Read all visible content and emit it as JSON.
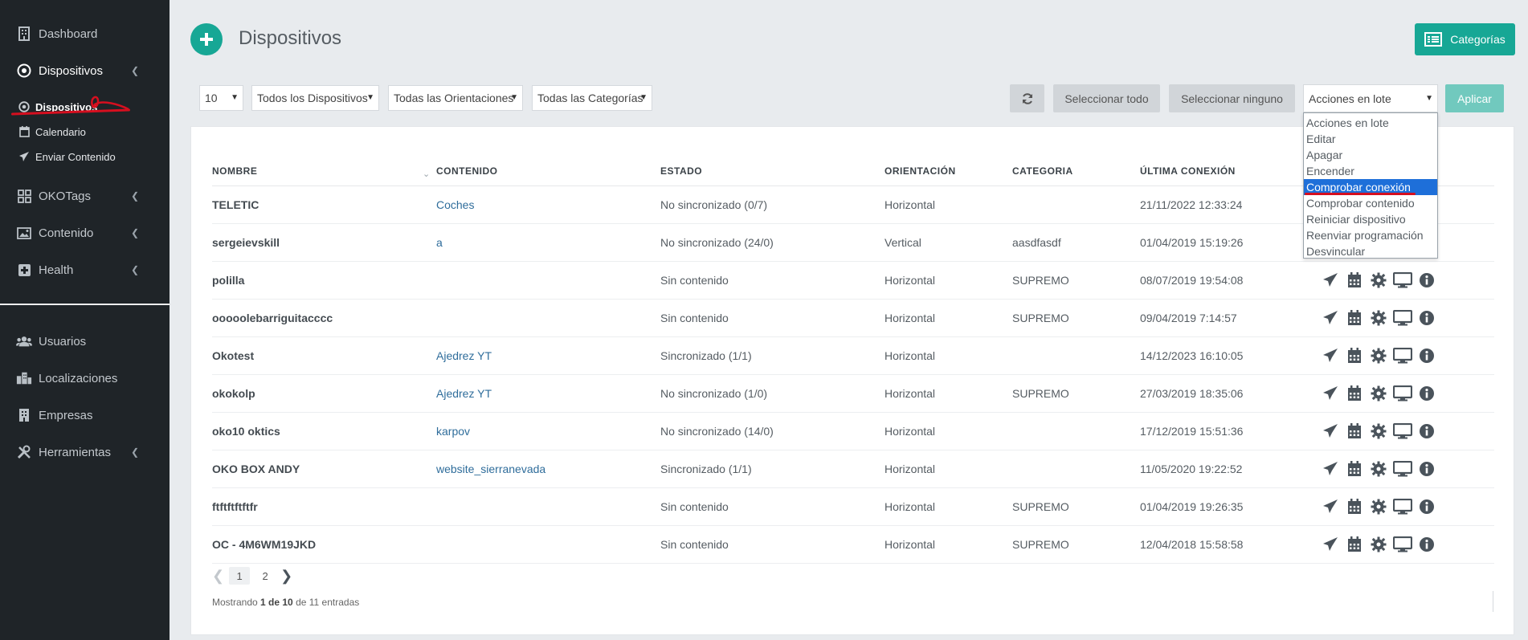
{
  "sidebar": {
    "dashboard": "Dashboard",
    "dispositivos": "Dispositivos",
    "sub": {
      "dispositivos": "Dispositivos",
      "calendario": "Calendario",
      "enviar": "Enviar Contenido"
    },
    "okotags": "OKOTags",
    "contenido": "Contenido",
    "health": "Health",
    "usuarios": "Usuarios",
    "localizaciones": "Localizaciones",
    "empresas": "Empresas",
    "herramientas": "Herramientas"
  },
  "header": {
    "title": "Dispositivos",
    "categorias_button": "Categorías"
  },
  "filters": {
    "page_size": "10",
    "devices": "Todos los Dispositivos",
    "orientations": "Todas las Orientaciones",
    "categories": "Todas las Categorías",
    "select_all": "Seleccionar todo",
    "select_none": "Seleccionar ninguno",
    "bulk_actions": "Acciones en lote",
    "apply": "Aplicar"
  },
  "bulk_dropdown": {
    "options": [
      "Acciones en lote",
      "Editar",
      "Apagar",
      "Encender",
      "Comprobar conexión",
      "Comprobar contenido",
      "Reiniciar dispositivo",
      "Reenviar programación",
      "Desvincular"
    ],
    "highlighted": "Comprobar conexión"
  },
  "table": {
    "headers": [
      "NOMBRE",
      "CONTENIDO",
      "ESTADO",
      "ORIENTACIÓN",
      "CATEGORIA",
      "ÚLTIMA CONEXIÓN"
    ],
    "rows": [
      {
        "name": "TELETIC",
        "content": "Coches",
        "status": "No sincronizado (0/7)",
        "orientation": "Horizontal",
        "category": "",
        "last": "21/11/2022 12:33:24"
      },
      {
        "name": "sergeievskill",
        "content": "a",
        "status": "No sincronizado (24/0)",
        "orientation": "Vertical",
        "category": "aasdfasdf",
        "last": "01/04/2019 15:19:26"
      },
      {
        "name": "polilla",
        "content": "",
        "status": "Sin contenido",
        "orientation": "Horizontal",
        "category": "SUPREMO",
        "last": "08/07/2019 19:54:08"
      },
      {
        "name": "ooooolebarriguitacccc",
        "content": "",
        "status": "Sin contenido",
        "orientation": "Horizontal",
        "category": "SUPREMO",
        "last": "09/04/2019 7:14:57"
      },
      {
        "name": "Okotest",
        "content": "Ajedrez YT",
        "status": "Sincronizado (1/1)",
        "orientation": "Horizontal",
        "category": "",
        "last": "14/12/2023 16:10:05"
      },
      {
        "name": "okokolp",
        "content": "Ajedrez YT",
        "status": "No sincronizado (1/0)",
        "orientation": "Horizontal",
        "category": "SUPREMO",
        "last": "27/03/2019 18:35:06"
      },
      {
        "name": "oko10 oktics",
        "content": "karpov",
        "status": "No sincronizado (14/0)",
        "orientation": "Horizontal",
        "category": "",
        "last": "17/12/2019 15:51:36"
      },
      {
        "name": "OKO BOX ANDY",
        "content": "website_sierranevada",
        "status": "Sincronizado (1/1)",
        "orientation": "Horizontal",
        "category": "",
        "last": "11/05/2020 19:22:52"
      },
      {
        "name": "ftftftftftfr",
        "content": "",
        "status": "Sin contenido",
        "orientation": "Horizontal",
        "category": "SUPREMO",
        "last": "01/04/2019 19:26:35"
      },
      {
        "name": "OC - 4M6WM19JKD",
        "content": "",
        "status": "Sin contenido",
        "orientation": "Horizontal",
        "category": "SUPREMO",
        "last": "12/04/2018 15:58:58"
      }
    ]
  },
  "pagination": {
    "pages": [
      "1",
      "2"
    ],
    "current": "1",
    "showing_prefix": "Mostrando ",
    "showing_range": "1 de 10",
    "showing_suffix": " de 11 entradas"
  }
}
